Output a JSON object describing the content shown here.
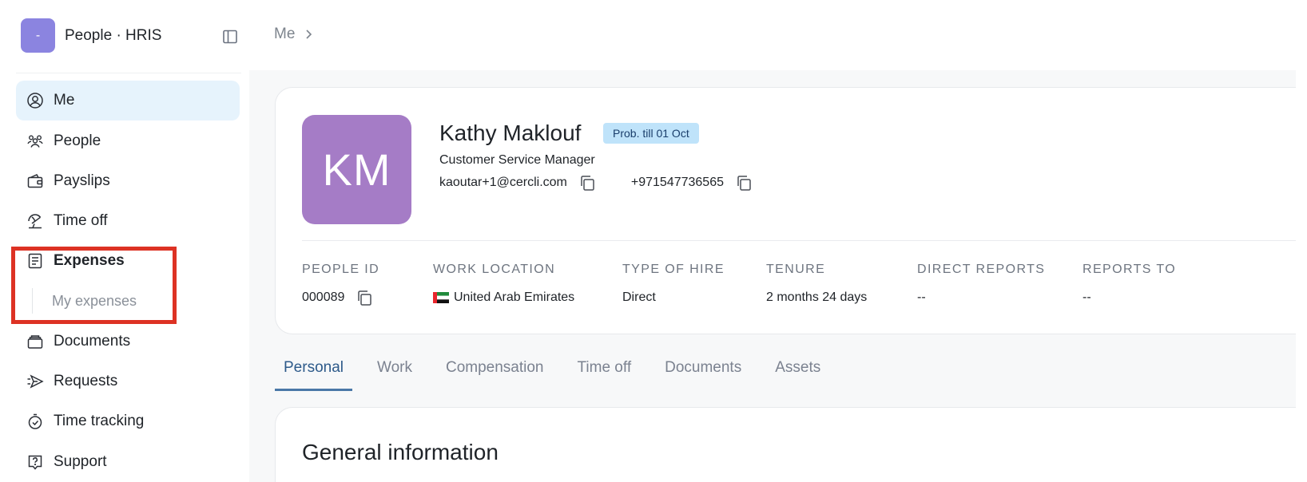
{
  "brand": {
    "logo_text": "-",
    "name": "People · HRIS"
  },
  "sidebar": {
    "items": [
      {
        "label": "Me",
        "icon": "user-circle-icon"
      },
      {
        "label": "People",
        "icon": "people-icon"
      },
      {
        "label": "Payslips",
        "icon": "wallet-icon"
      },
      {
        "label": "Time off",
        "icon": "umbrella-icon"
      },
      {
        "label": "Expenses",
        "icon": "receipt-icon"
      },
      {
        "label": "Documents",
        "icon": "documents-icon"
      },
      {
        "label": "Requests",
        "icon": "send-icon"
      },
      {
        "label": "Time tracking",
        "icon": "stopwatch-icon"
      },
      {
        "label": "Support",
        "icon": "help-icon"
      }
    ],
    "sub_items": {
      "expenses": "My expenses"
    }
  },
  "breadcrumb": {
    "root": "Me"
  },
  "profile": {
    "initials": "KM",
    "name": "Kathy Maklouf",
    "badge": "Prob. till 01 Oct",
    "job_title": "Customer Service Manager",
    "email": "kaoutar+1@cercli.com",
    "phone": "+971547736565",
    "info": {
      "people_id_label": "PEOPLE ID",
      "people_id": "000089",
      "work_location_label": "WORK LOCATION",
      "work_location": "United Arab Emirates",
      "type_of_hire_label": "TYPE OF HIRE",
      "type_of_hire": "Direct",
      "tenure_label": "TENURE",
      "tenure": "2 months 24 days",
      "direct_reports_label": "DIRECT REPORTS",
      "direct_reports": "--",
      "reports_to_label": "REPORTS TO",
      "reports_to": "--"
    }
  },
  "tabs": [
    "Personal",
    "Work",
    "Compensation",
    "Time off",
    "Documents",
    "Assets"
  ],
  "section": {
    "title": "General information"
  },
  "colors": {
    "accent": "#4a78a8",
    "active_nav_bg": "#e6f3fc",
    "avatar_bg": "#a57cc6",
    "badge_bg": "#bfe3fa",
    "highlight": "#dd3224"
  }
}
